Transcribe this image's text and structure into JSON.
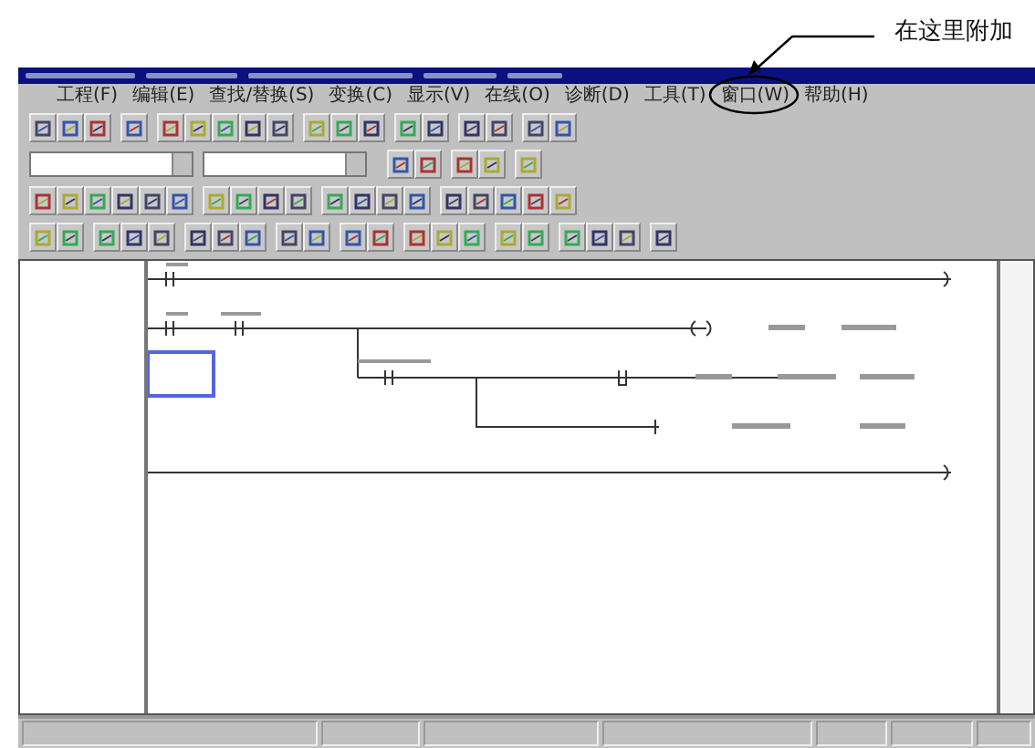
{
  "annotation": {
    "label": "在这里附加"
  },
  "menu": [
    {
      "label": "工程(F)"
    },
    {
      "label": "编辑(E)"
    },
    {
      "label": "查找/替换(S)"
    },
    {
      "label": "变换(C)"
    },
    {
      "label": "显示(V)"
    },
    {
      "label": "在线(O)"
    },
    {
      "label": "诊断(D)"
    },
    {
      "label": "工具(T)"
    },
    {
      "label": "窗口(W)"
    },
    {
      "label": "帮助(H)"
    }
  ]
}
